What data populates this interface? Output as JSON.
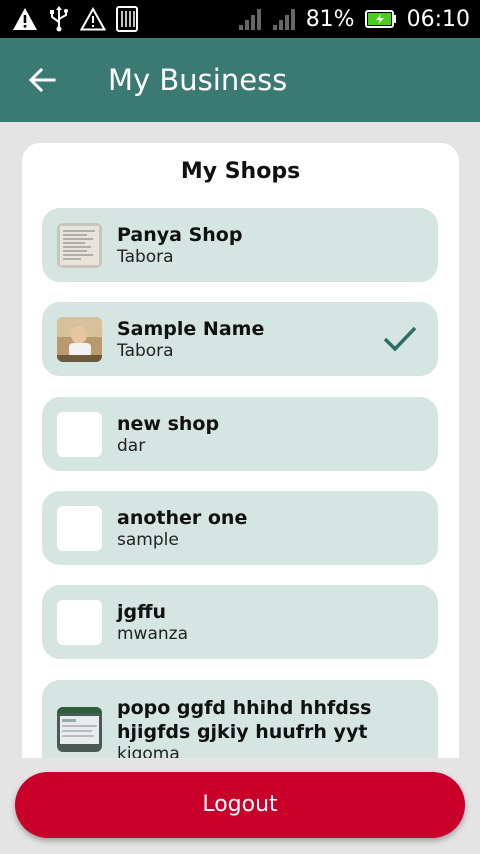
{
  "status_bar": {
    "battery": "81%",
    "time": "06:10",
    "icons": [
      "warning-icon",
      "usb-icon",
      "warning-outline-icon",
      "sim-icon",
      "signal-icon",
      "signal-icon",
      "battery-charging-icon"
    ]
  },
  "app_bar": {
    "title": "My Business",
    "back_icon": "arrow-back-icon",
    "color": "#3a7a72"
  },
  "shops_card": {
    "title": "My Shops",
    "items": [
      {
        "name": "Panya Shop",
        "location": "Tabora",
        "thumbnail": "document-photo",
        "selected": false
      },
      {
        "name": "Sample Name",
        "location": "Tabora",
        "thumbnail": "baby-photo",
        "selected": true
      },
      {
        "name": "new shop",
        "location": "dar",
        "thumbnail": "blank",
        "selected": false
      },
      {
        "name": "another one",
        "location": "sample",
        "thumbnail": "blank",
        "selected": false
      },
      {
        "name": "jgffu",
        "location": "mwanza",
        "thumbnail": "blank",
        "selected": false
      },
      {
        "name": "popo ggfd hhihd hhfdss hjigfds gjkiy huufrh yyt",
        "location": "kigoma",
        "thumbnail": "screenshot-photo",
        "selected": false
      }
    ]
  },
  "logout": {
    "label": "Logout",
    "color": "#c8002a"
  }
}
